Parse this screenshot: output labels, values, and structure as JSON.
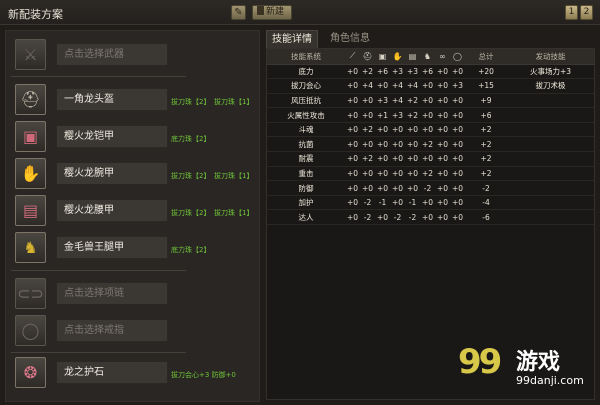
{
  "window": {
    "title": "新配装方案",
    "edit_icon": "pencil-icon",
    "new_label": "新建",
    "pages": [
      "1",
      "2"
    ]
  },
  "slots": [
    {
      "icon": "sword-icon",
      "name": "点击选择武器",
      "placeholder": true,
      "jewels": []
    },
    {
      "icon": "helmet-icon",
      "name": "一角龙头盔",
      "placeholder": false,
      "jewels": [
        "拔刀珠【2】",
        "拔刀珠【1】"
      ]
    },
    {
      "icon": "chest-armor-icon",
      "name": "樱火龙铠甲",
      "placeholder": false,
      "jewels": [
        "底力珠【2】"
      ]
    },
    {
      "icon": "gauntlet-icon",
      "name": "樱火龙腕甲",
      "placeholder": false,
      "jewels": [
        "拔刀珠【2】",
        "拔刀珠【1】"
      ]
    },
    {
      "icon": "waist-armor-icon",
      "name": "樱火龙腰甲",
      "placeholder": false,
      "jewels": [
        "拔刀珠【2】",
        "拔刀珠【1】"
      ]
    },
    {
      "icon": "leg-armor-icon",
      "name": "金毛兽王腿甲",
      "placeholder": false,
      "jewels": [
        "底力珠【2】"
      ]
    },
    {
      "icon": "necklace-icon",
      "name": "点击选择项链",
      "placeholder": true,
      "jewels": []
    },
    {
      "icon": "ring-icon",
      "name": "点击选择戒指",
      "placeholder": true,
      "jewels": []
    },
    {
      "icon": "charm-icon",
      "name": "龙之护石",
      "placeholder": false,
      "jewels": [
        "拔刀会心+3 防御+0"
      ]
    }
  ],
  "tabs": [
    "技能详情",
    "角色信息"
  ],
  "table": {
    "headers": [
      "技能系统",
      "sword-icon",
      "helmet-icon",
      "chest-armor-icon",
      "gauntlet-icon",
      "waist-armor-icon",
      "leg-armor-icon",
      "necklace-icon",
      "ring-icon",
      "总计",
      "发动技能"
    ],
    "rows": [
      {
        "skill": "底力",
        "values": [
          "+0",
          "+2",
          "+6",
          "+3",
          "+3",
          "+6",
          "+0",
          "+0"
        ],
        "total": "+20",
        "effect": "火事场力+3"
      },
      {
        "skill": "拔刀会心",
        "values": [
          "+0",
          "+4",
          "+0",
          "+4",
          "+4",
          "+0",
          "+0",
          "+3"
        ],
        "total": "+15",
        "effect": "拔刀术极"
      },
      {
        "skill": "风压抵抗",
        "values": [
          "+0",
          "+0",
          "+3",
          "+4",
          "+2",
          "+0",
          "+0",
          "+0"
        ],
        "total": "+9",
        "effect": ""
      },
      {
        "skill": "火属性攻击",
        "values": [
          "+0",
          "+0",
          "+1",
          "+3",
          "+2",
          "+0",
          "+0",
          "+0"
        ],
        "total": "+6",
        "effect": ""
      },
      {
        "skill": "斗魂",
        "values": [
          "+0",
          "+2",
          "+0",
          "+0",
          "+0",
          "+0",
          "+0",
          "+0"
        ],
        "total": "+2",
        "effect": ""
      },
      {
        "skill": "抗菌",
        "values": [
          "+0",
          "+0",
          "+0",
          "+0",
          "+0",
          "+2",
          "+0",
          "+0"
        ],
        "total": "+2",
        "effect": ""
      },
      {
        "skill": "耐震",
        "values": [
          "+0",
          "+2",
          "+0",
          "+0",
          "+0",
          "+0",
          "+0",
          "+0"
        ],
        "total": "+2",
        "effect": ""
      },
      {
        "skill": "重击",
        "values": [
          "+0",
          "+0",
          "+0",
          "+0",
          "+0",
          "+2",
          "+0",
          "+0"
        ],
        "total": "+2",
        "effect": ""
      },
      {
        "skill": "防御",
        "values": [
          "+0",
          "+0",
          "+0",
          "+0",
          "+0",
          "-2",
          "+0",
          "+0"
        ],
        "total": "-2",
        "effect": ""
      },
      {
        "skill": "加护",
        "values": [
          "+0",
          "-2",
          "-1",
          "+0",
          "-1",
          "+0",
          "+0",
          "+0"
        ],
        "total": "-4",
        "effect": ""
      },
      {
        "skill": "达人",
        "values": [
          "+0",
          "-2",
          "+0",
          "-2",
          "-2",
          "+0",
          "+0",
          "+0"
        ],
        "total": "-6",
        "effect": ""
      }
    ]
  },
  "watermark": {
    "logo": "99",
    "text": "游戏",
    "url": "99danji.com"
  }
}
